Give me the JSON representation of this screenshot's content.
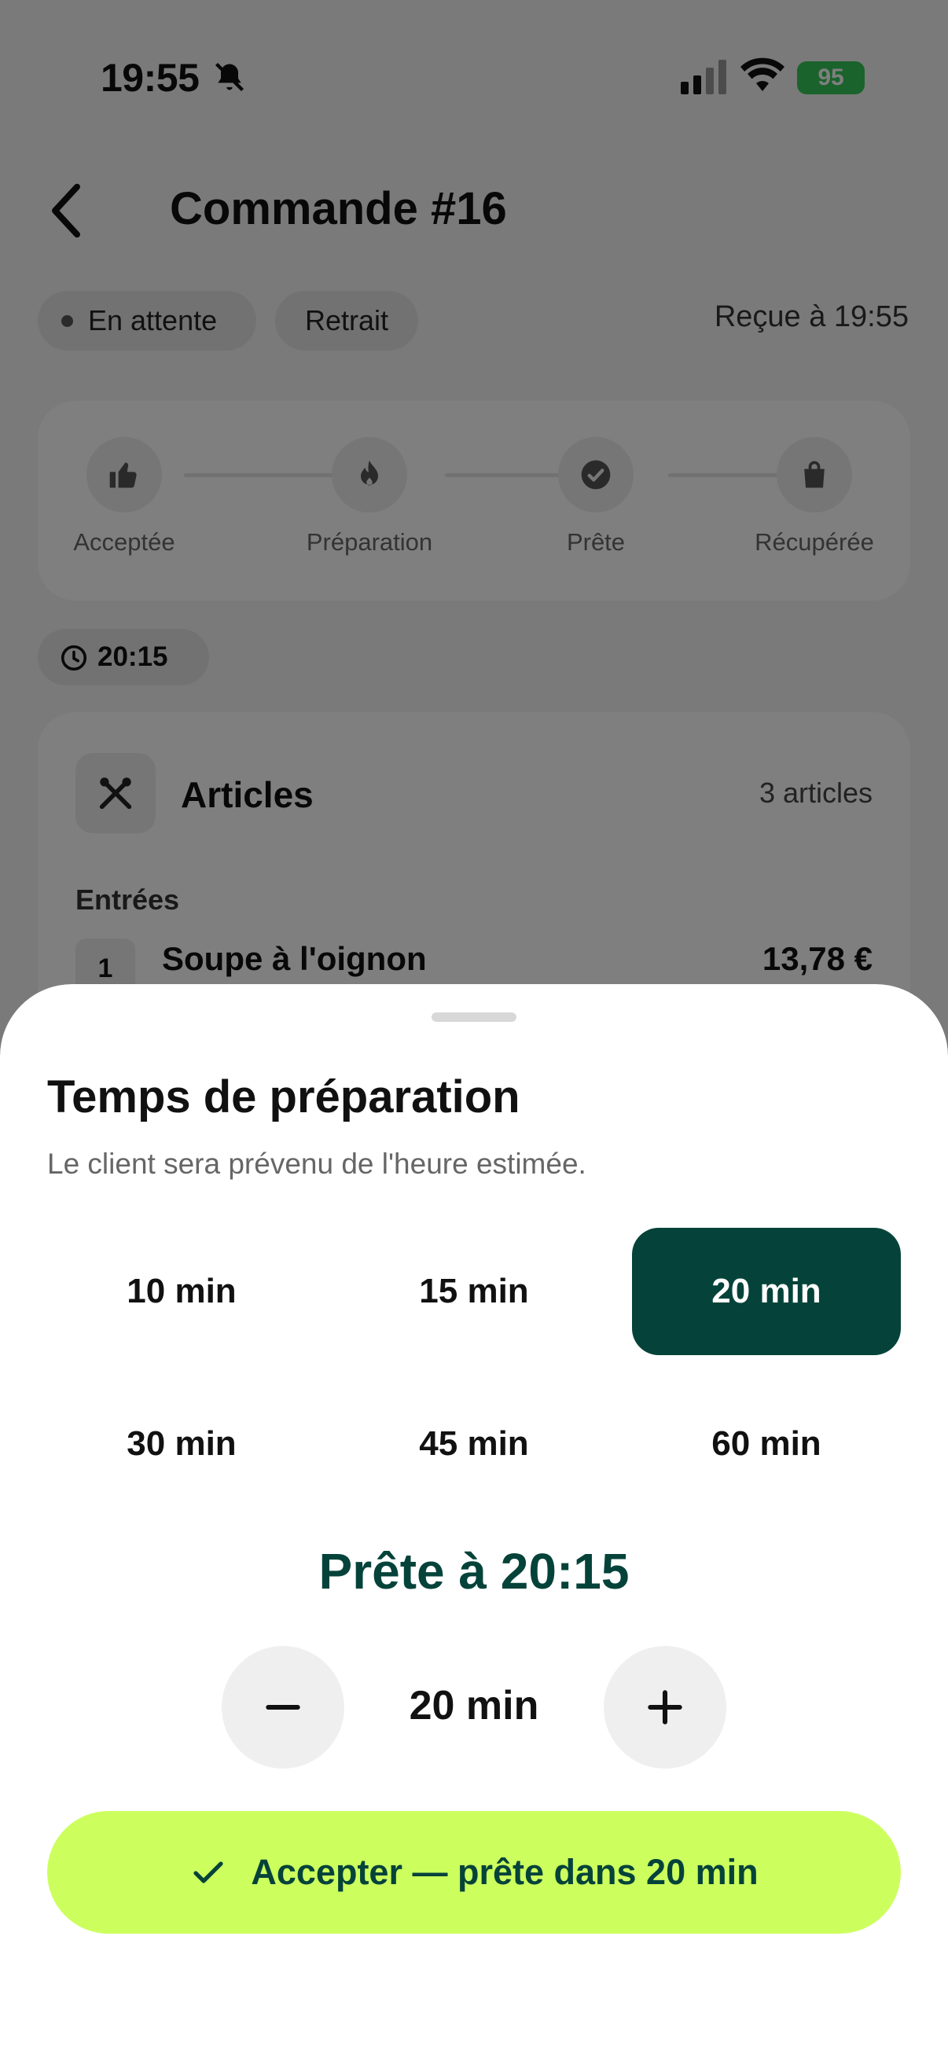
{
  "status_bar": {
    "time": "19:55",
    "battery": "95"
  },
  "nav": {
    "title": "Commande #16"
  },
  "order": {
    "status": "En attente",
    "mode": "Retrait",
    "received": "Reçue à 19:55",
    "eta_chip": "20:15"
  },
  "progress": {
    "steps": [
      {
        "label": "Acceptée",
        "icon": "thumbs-up-icon"
      },
      {
        "label": "Préparation",
        "icon": "flame-icon"
      },
      {
        "label": "Prête",
        "icon": "check-circle-icon"
      },
      {
        "label": "Récupérée",
        "icon": "bag-icon"
      }
    ]
  },
  "items": {
    "title": "Articles",
    "count": "3 articles",
    "section": "Entrées",
    "first": {
      "qty": "1",
      "name": "Soupe à l'oignon",
      "price": "13,78 €"
    }
  },
  "sheet": {
    "title": "Temps de préparation",
    "subtitle": "Le client sera prévenu de l'heure estimée.",
    "options": [
      "10 min",
      "15 min",
      "20 min",
      "30 min",
      "45 min",
      "60 min"
    ],
    "selected": "20 min",
    "ready_text": "Prête à 20:15",
    "stepper_value": "20 min",
    "accept_label": "Accepter — prête dans 20 min"
  },
  "colors": {
    "primary": "#05433a",
    "accent": "#ccff5e",
    "battery": "#34c759"
  }
}
